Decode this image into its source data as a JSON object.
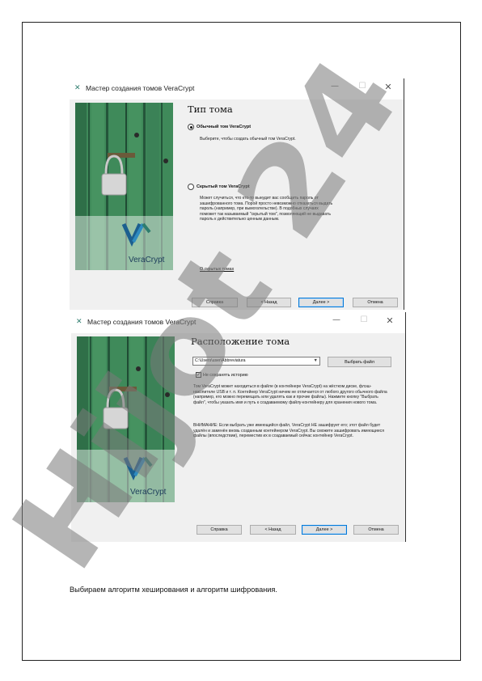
{
  "page": {
    "caption": "Выбираем алгоритм хеширования и алгоритм шифрования."
  },
  "colors": {
    "window_bg": "#f0f0f0",
    "accent_green": "#2e7d6e",
    "veracrypt_blue": "#1b5f8f",
    "watermark_gray": "#7a7a7a",
    "watermark_violet": "#c9c3f3",
    "primary_button_border": "#0078d7"
  },
  "window1": {
    "title": "Мастер создания томов VeraCrypt",
    "heading": "Тип тома",
    "image_logo_text": "VeraCrypt",
    "option_standard": {
      "label": "Обычный том VeraCrypt",
      "description": "Выберите, чтобы создать обычный том VeraCrypt.",
      "selected": true
    },
    "option_hidden": {
      "label": "Скрытый том VeraCrypt",
      "description": "Может случиться, что кто-то вынудит вас сообщить пароль от зашифрованного тома. Порой просто невозможно отказаться выдать пароль (например, при вымогательстве). В подобных случаях поможет так называемый \"скрытый том\", позволяющий не выдавать пароль к действительно ценным данным.",
      "selected": false
    },
    "link": "О скрытых томах",
    "buttons": {
      "help": "Справка",
      "back": "< Назад",
      "next": "Далее >",
      "cancel": "Отмена"
    }
  },
  "window2": {
    "title": "Мастер создания томов VeraCrypt",
    "heading": "Расположение тома",
    "image_logo_text": "VeraCrypt",
    "path_value": "C:\\Users\\user\\Abbreviatura",
    "select_file_button": "Выбрать файл",
    "no_history_label": "Не сохранять историю",
    "no_history_checked": true,
    "paragraph1": "Том VeraCrypt может находиться в файле (в контейнере VeraCrypt) на жёстком диске, флэш-накопителе USB и т. п. Контейнер VeraCrypt ничем не отличается от любого другого обычного файла (например, его можно перемещать или удалять как и прочие файлы). Нажмите кнопку \"Выбрать файл\", чтобы указать имя и путь к создаваемому файлу-контейнеру для хранения нового тома.",
    "paragraph2": "ВНИМАНИЕ: Если выбрать уже имеющийся файл, VeraCrypt НЕ зашифрует его; этот файл будет удалён и заменён вновь созданным контейнером VeraCrypt. Вы сможете зашифровать имеющиеся файлы (впоследствии), переместив их в создаваемый сейчас контейнер VeraCrypt.",
    "buttons": {
      "help": "Справка",
      "back": "< Назад",
      "next": "Далее >",
      "cancel": "Отмена"
    }
  },
  "watermark": {
    "text": "Hijot 24"
  }
}
